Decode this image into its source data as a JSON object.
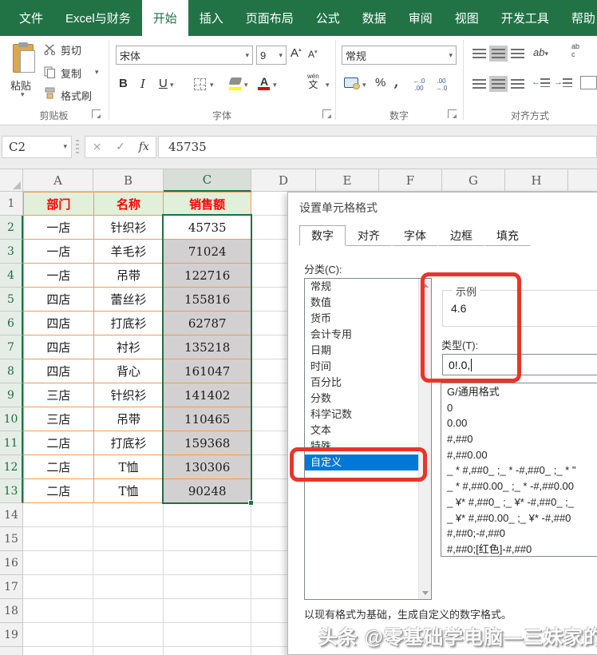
{
  "colors": {
    "excel_green": "#217346",
    "selection_blue": "#0078D7",
    "annotation_red": "#E8352B",
    "table_header_fill": "#E2EFDA",
    "table_header_text": "#FF0000",
    "table_border_orange": "#ED9C5A",
    "selected_cells_fill": "#D2D0D0"
  },
  "ribbon_tabs": [
    "文件",
    "Excel与财务",
    "开始",
    "插入",
    "页面布局",
    "公式",
    "数据",
    "审阅",
    "视图",
    "开发工具",
    "帮助"
  ],
  "active_tab": "开始",
  "ribbon": {
    "clipboard": {
      "group": "剪贴板",
      "paste": "粘贴",
      "cut": "剪切",
      "copy": "复制",
      "format_painter": "格式刷"
    },
    "font": {
      "group": "字体",
      "font_name": "宋体",
      "font_size": "9",
      "bold": "B",
      "italic": "I",
      "underline": "U",
      "grow_font": "A",
      "shrink_font": "A",
      "font_color_letter": "A",
      "pinyin_top": "wén",
      "pinyin_bottom": "文"
    },
    "number": {
      "group": "数字",
      "format": "常规",
      "percent": "%",
      "comma": ",",
      "inc_dec_top": "←.0",
      "inc_dec_bottom": ".00",
      "dec_dec_top": ".00",
      "dec_dec_bottom": "→.0"
    },
    "alignment": {
      "group": "对齐方式",
      "orientation": "ab",
      "wrap_top": "ab",
      "wrap_bottom": "c"
    },
    "icons": {
      "down": "▾",
      "up": "▴",
      "left": "←",
      "right": "→"
    }
  },
  "formula_bar": {
    "cell_ref": "C2",
    "cancel": "×",
    "enter": "✓",
    "fx_label": "fx",
    "value": "45735"
  },
  "sheet": {
    "col_headers": [
      "A",
      "B",
      "C",
      "D",
      "E",
      "F",
      "G",
      "H"
    ],
    "row_numbers": [
      "1",
      "2",
      "3",
      "4",
      "5",
      "6",
      "7",
      "8",
      "9",
      "10",
      "11",
      "12",
      "13",
      "14",
      "15",
      "16",
      "17",
      "18",
      "19"
    ],
    "table_headers": [
      "部门",
      "名称",
      "销售额"
    ],
    "rows": [
      [
        "一店",
        "针织衫",
        "45735"
      ],
      [
        "一店",
        "羊毛衫",
        "71024"
      ],
      [
        "一店",
        "吊带",
        "122716"
      ],
      [
        "四店",
        "蕾丝衫",
        "155816"
      ],
      [
        "四店",
        "打底衫",
        "62787"
      ],
      [
        "四店",
        "衬衫",
        "135218"
      ],
      [
        "四店",
        "背心",
        "161047"
      ],
      [
        "三店",
        "针织衫",
        "141402"
      ],
      [
        "三店",
        "吊带",
        "110465"
      ],
      [
        "二店",
        "打底衫",
        "159368"
      ],
      [
        "二店",
        "T恤",
        "130306"
      ],
      [
        "二店",
        "T恤",
        "90248"
      ]
    ]
  },
  "dialog": {
    "title": "设置单元格格式",
    "tabs": [
      "数字",
      "对齐",
      "字体",
      "边框",
      "填充"
    ],
    "category_label": "分类(C):",
    "categories": [
      "常规",
      "数值",
      "货币",
      "会计专用",
      "日期",
      "时间",
      "百分比",
      "分数",
      "科学记数",
      "文本",
      "特殊",
      "自定义"
    ],
    "selected_category": "自定义",
    "example_legend": "示例",
    "example_value": "4.6",
    "type_label": "类型(T):",
    "type_value": "0!.0,",
    "format_codes": [
      "G/通用格式",
      "0",
      "0.00",
      "#,##0",
      "#,##0.00",
      "_ * #,##0_ ;_ * -#,##0_ ;_ * \"",
      "_ * #,##0.00_ ;_ * -#,##0.00",
      "_ ¥* #,##0_ ;_ ¥* -#,##0_ ;_",
      "_ ¥* #,##0.00_ ;_ ¥* -#,##0",
      "#,##0;-#,##0",
      "#,##0;[红色]-#,##0"
    ],
    "help_text": "以现有格式为基础，生成自定义的数字格式。"
  },
  "watermark": "头条 @零基础学电脑—三妹家的二傻子"
}
